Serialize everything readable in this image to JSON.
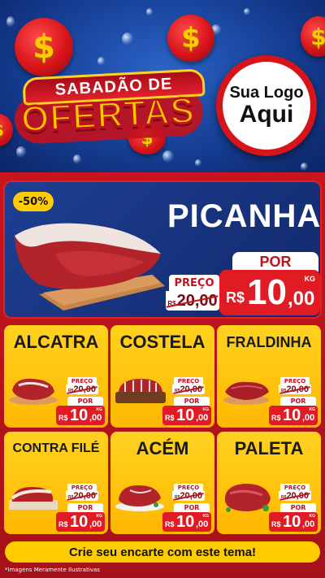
{
  "header": {
    "banner_line1": "SABADÃO DE",
    "banner_line2": "OFERTAS",
    "logo_line1": "Sua Logo",
    "logo_line2": "Aqui",
    "coin_symbol": "$"
  },
  "featured": {
    "discount": "-50%",
    "name": "PICANHA",
    "price_label": "PREÇO",
    "old_currency": "R$",
    "old_price": "20,00",
    "por_label": "POR",
    "currency": "R$",
    "price_int": "10",
    "price_cents": ",00",
    "unit": "KG"
  },
  "products": [
    {
      "name": "ALCATRA",
      "price_label": "PREÇO",
      "old_currency": "R$",
      "old_price": "20,00",
      "por_label": "POR",
      "currency": "R$",
      "price_int": "10",
      "price_cents": ",00",
      "unit": "KG"
    },
    {
      "name": "COSTELA",
      "price_label": "PREÇO",
      "old_currency": "R$",
      "old_price": "20,00",
      "por_label": "POR",
      "currency": "R$",
      "price_int": "10",
      "price_cents": ",00",
      "unit": "KG"
    },
    {
      "name": "FRALDINHA",
      "price_label": "PREÇO",
      "old_currency": "R$",
      "old_price": "20,00",
      "por_label": "POR",
      "currency": "R$",
      "price_int": "10",
      "price_cents": ",00",
      "unit": "KG"
    },
    {
      "name": "CONTRA FILÉ",
      "price_label": "PREÇO",
      "old_currency": "R$",
      "old_price": "20,00",
      "por_label": "POR",
      "currency": "R$",
      "price_int": "10",
      "price_cents": ",00",
      "unit": "KG"
    },
    {
      "name": "ACÉM",
      "price_label": "PREÇO",
      "old_currency": "R$",
      "old_price": "20,00",
      "por_label": "POR",
      "currency": "R$",
      "price_int": "10",
      "price_cents": ",00",
      "unit": "KG"
    },
    {
      "name": "PALETA",
      "price_label": "PREÇO",
      "old_currency": "R$",
      "old_price": "20,00",
      "por_label": "POR",
      "currency": "R$",
      "price_int": "10",
      "price_cents": ",00",
      "unit": "KG"
    }
  ],
  "cta": "Crie seu encarte com este tema!",
  "disclaimer": "*Imagens Meramente Ilustrativas",
  "colors": {
    "brand_red": "#e11b23",
    "brand_yellow": "#ffcc00",
    "brand_blue": "#163f95"
  }
}
